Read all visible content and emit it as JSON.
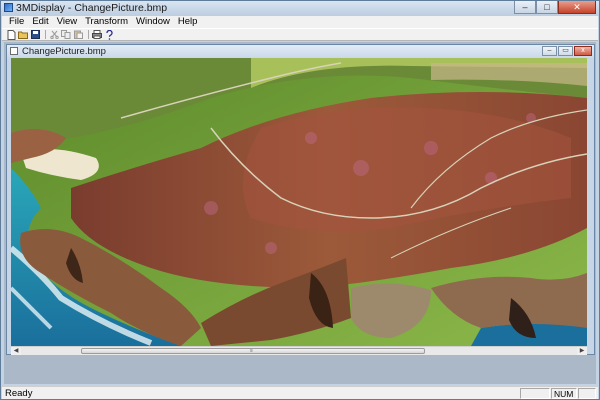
{
  "app": {
    "title": "3MDisplay - ChangePicture.bmp"
  },
  "window_controls": {
    "minimize": "–",
    "maximize": "□",
    "close": "✕"
  },
  "menu": {
    "items": [
      "File",
      "Edit",
      "View",
      "Transform",
      "Window",
      "Help"
    ]
  },
  "toolbar": {
    "buttons": [
      "new-file-icon",
      "open-folder-icon",
      "save-icon",
      "cut-icon",
      "copy-icon",
      "paste-icon",
      "print-icon",
      "help-icon"
    ]
  },
  "child": {
    "title": "ChangePicture.bmp",
    "controls": {
      "minimize": "–",
      "restore": "▭",
      "close": "x"
    }
  },
  "scrollbar": {
    "left_arrow": "◀",
    "right_arrow": "▶",
    "grip": "≡"
  },
  "status": {
    "text": "Ready",
    "num": "NUM"
  },
  "colors": {
    "sea": "#1f8fb0",
    "grass": "#7cae3a",
    "heather": "#8a4a38",
    "cliff": "#8a5a3c"
  }
}
